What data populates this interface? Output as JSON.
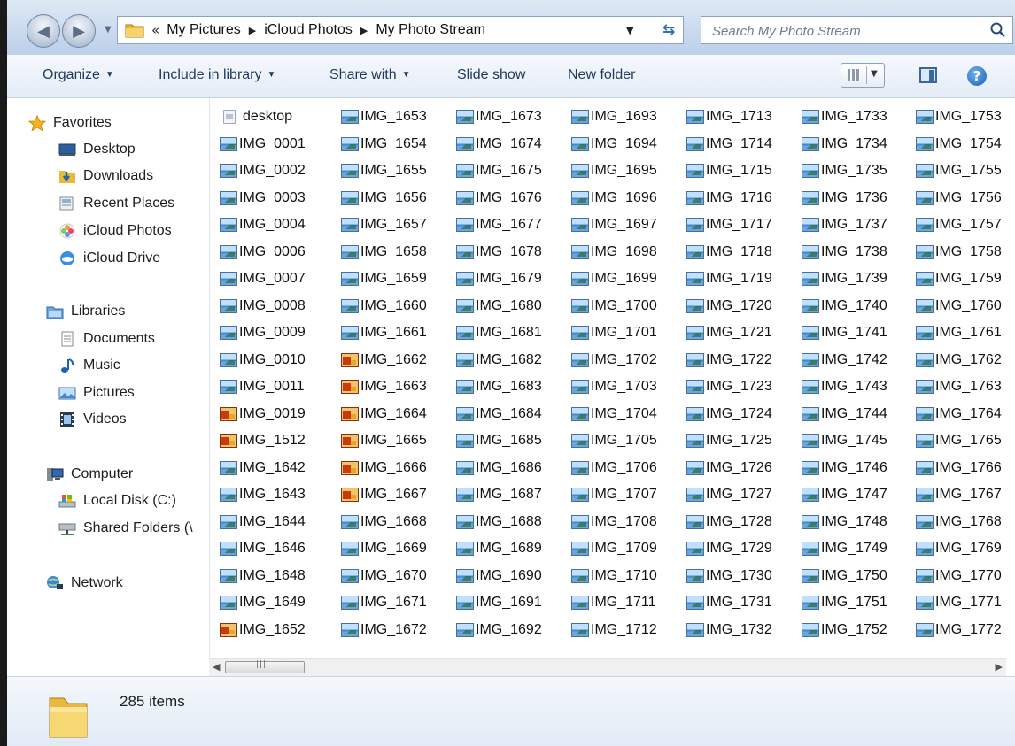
{
  "window": {
    "breadcrumb": [
      "My Pictures",
      "iCloud Photos",
      "My Photo Stream"
    ],
    "search_placeholder": "Search My Photo Stream"
  },
  "toolbar": {
    "organize": "Organize",
    "include": "Include in library",
    "share": "Share with",
    "slideshow": "Slide show",
    "newfolder": "New folder"
  },
  "nav": {
    "favorites": "Favorites",
    "desktop": "Desktop",
    "downloads": "Downloads",
    "recent": "Recent Places",
    "icloud_photos": "iCloud Photos",
    "icloud_drive": "iCloud Drive",
    "libraries": "Libraries",
    "documents": "Documents",
    "music": "Music",
    "pictures": "Pictures",
    "videos": "Videos",
    "computer": "Computer",
    "local_disk": "Local Disk (C:)",
    "shared": "Shared Folders (\\",
    "network": "Network"
  },
  "files": [
    [
      {
        "name": "desktop",
        "type": "desk"
      },
      {
        "name": "IMG_0001",
        "type": "img"
      },
      {
        "name": "IMG_0002",
        "type": "img"
      },
      {
        "name": "IMG_0003",
        "type": "img"
      },
      {
        "name": "IMG_0004",
        "type": "img"
      },
      {
        "name": "IMG_0006",
        "type": "img"
      },
      {
        "name": "IMG_0007",
        "type": "img"
      },
      {
        "name": "IMG_0008",
        "type": "img"
      },
      {
        "name": "IMG_0009",
        "type": "img"
      },
      {
        "name": "IMG_0010",
        "type": "img"
      },
      {
        "name": "IMG_0011",
        "type": "img"
      },
      {
        "name": "IMG_0019",
        "type": "raw"
      },
      {
        "name": "IMG_1512",
        "type": "raw"
      },
      {
        "name": "IMG_1642",
        "type": "img"
      },
      {
        "name": "IMG_1643",
        "type": "img"
      },
      {
        "name": "IMG_1644",
        "type": "img"
      },
      {
        "name": "IMG_1646",
        "type": "img"
      },
      {
        "name": "IMG_1648",
        "type": "img"
      },
      {
        "name": "IMG_1649",
        "type": "img"
      },
      {
        "name": "IMG_1652",
        "type": "raw"
      }
    ],
    [
      {
        "name": "IMG_1653",
        "type": "img"
      },
      {
        "name": "IMG_1654",
        "type": "img"
      },
      {
        "name": "IMG_1655",
        "type": "img"
      },
      {
        "name": "IMG_1656",
        "type": "img"
      },
      {
        "name": "IMG_1657",
        "type": "img"
      },
      {
        "name": "IMG_1658",
        "type": "img"
      },
      {
        "name": "IMG_1659",
        "type": "img"
      },
      {
        "name": "IMG_1660",
        "type": "img"
      },
      {
        "name": "IMG_1661",
        "type": "img"
      },
      {
        "name": "IMG_1662",
        "type": "raw"
      },
      {
        "name": "IMG_1663",
        "type": "raw"
      },
      {
        "name": "IMG_1664",
        "type": "raw"
      },
      {
        "name": "IMG_1665",
        "type": "raw"
      },
      {
        "name": "IMG_1666",
        "type": "raw"
      },
      {
        "name": "IMG_1667",
        "type": "raw"
      },
      {
        "name": "IMG_1668",
        "type": "img"
      },
      {
        "name": "IMG_1669",
        "type": "img"
      },
      {
        "name": "IMG_1670",
        "type": "img"
      },
      {
        "name": "IMG_1671",
        "type": "img"
      },
      {
        "name": "IMG_1672",
        "type": "img"
      }
    ],
    [
      {
        "name": "IMG_1673",
        "type": "img"
      },
      {
        "name": "IMG_1674",
        "type": "img"
      },
      {
        "name": "IMG_1675",
        "type": "img"
      },
      {
        "name": "IMG_1676",
        "type": "img"
      },
      {
        "name": "IMG_1677",
        "type": "img"
      },
      {
        "name": "IMG_1678",
        "type": "img"
      },
      {
        "name": "IMG_1679",
        "type": "img"
      },
      {
        "name": "IMG_1680",
        "type": "img"
      },
      {
        "name": "IMG_1681",
        "type": "img"
      },
      {
        "name": "IMG_1682",
        "type": "img"
      },
      {
        "name": "IMG_1683",
        "type": "img"
      },
      {
        "name": "IMG_1684",
        "type": "img"
      },
      {
        "name": "IMG_1685",
        "type": "img"
      },
      {
        "name": "IMG_1686",
        "type": "img"
      },
      {
        "name": "IMG_1687",
        "type": "img"
      },
      {
        "name": "IMG_1688",
        "type": "img"
      },
      {
        "name": "IMG_1689",
        "type": "img"
      },
      {
        "name": "IMG_1690",
        "type": "img"
      },
      {
        "name": "IMG_1691",
        "type": "img"
      },
      {
        "name": "IMG_1692",
        "type": "img"
      }
    ],
    [
      {
        "name": "IMG_1693",
        "type": "img"
      },
      {
        "name": "IMG_1694",
        "type": "img"
      },
      {
        "name": "IMG_1695",
        "type": "img"
      },
      {
        "name": "IMG_1696",
        "type": "img"
      },
      {
        "name": "IMG_1697",
        "type": "img"
      },
      {
        "name": "IMG_1698",
        "type": "img"
      },
      {
        "name": "IMG_1699",
        "type": "img"
      },
      {
        "name": "IMG_1700",
        "type": "img"
      },
      {
        "name": "IMG_1701",
        "type": "img"
      },
      {
        "name": "IMG_1702",
        "type": "img"
      },
      {
        "name": "IMG_1703",
        "type": "img"
      },
      {
        "name": "IMG_1704",
        "type": "img"
      },
      {
        "name": "IMG_1705",
        "type": "img"
      },
      {
        "name": "IMG_1706",
        "type": "img"
      },
      {
        "name": "IMG_1707",
        "type": "img"
      },
      {
        "name": "IMG_1708",
        "type": "img"
      },
      {
        "name": "IMG_1709",
        "type": "img"
      },
      {
        "name": "IMG_1710",
        "type": "img"
      },
      {
        "name": "IMG_1711",
        "type": "img"
      },
      {
        "name": "IMG_1712",
        "type": "img"
      }
    ],
    [
      {
        "name": "IMG_1713",
        "type": "img"
      },
      {
        "name": "IMG_1714",
        "type": "img"
      },
      {
        "name": "IMG_1715",
        "type": "img"
      },
      {
        "name": "IMG_1716",
        "type": "img"
      },
      {
        "name": "IMG_1717",
        "type": "img"
      },
      {
        "name": "IMG_1718",
        "type": "img"
      },
      {
        "name": "IMG_1719",
        "type": "img"
      },
      {
        "name": "IMG_1720",
        "type": "img"
      },
      {
        "name": "IMG_1721",
        "type": "img"
      },
      {
        "name": "IMG_1722",
        "type": "img"
      },
      {
        "name": "IMG_1723",
        "type": "img"
      },
      {
        "name": "IMG_1724",
        "type": "img"
      },
      {
        "name": "IMG_1725",
        "type": "img"
      },
      {
        "name": "IMG_1726",
        "type": "img"
      },
      {
        "name": "IMG_1727",
        "type": "img"
      },
      {
        "name": "IMG_1728",
        "type": "img"
      },
      {
        "name": "IMG_1729",
        "type": "img"
      },
      {
        "name": "IMG_1730",
        "type": "img"
      },
      {
        "name": "IMG_1731",
        "type": "img"
      },
      {
        "name": "IMG_1732",
        "type": "img"
      }
    ],
    [
      {
        "name": "IMG_1733",
        "type": "img"
      },
      {
        "name": "IMG_1734",
        "type": "img"
      },
      {
        "name": "IMG_1735",
        "type": "img"
      },
      {
        "name": "IMG_1736",
        "type": "img"
      },
      {
        "name": "IMG_1737",
        "type": "img"
      },
      {
        "name": "IMG_1738",
        "type": "img"
      },
      {
        "name": "IMG_1739",
        "type": "img"
      },
      {
        "name": "IMG_1740",
        "type": "img"
      },
      {
        "name": "IMG_1741",
        "type": "img"
      },
      {
        "name": "IMG_1742",
        "type": "img"
      },
      {
        "name": "IMG_1743",
        "type": "img"
      },
      {
        "name": "IMG_1744",
        "type": "img"
      },
      {
        "name": "IMG_1745",
        "type": "img"
      },
      {
        "name": "IMG_1746",
        "type": "img"
      },
      {
        "name": "IMG_1747",
        "type": "img"
      },
      {
        "name": "IMG_1748",
        "type": "img"
      },
      {
        "name": "IMG_1749",
        "type": "img"
      },
      {
        "name": "IMG_1750",
        "type": "img"
      },
      {
        "name": "IMG_1751",
        "type": "img"
      },
      {
        "name": "IMG_1752",
        "type": "img"
      }
    ],
    [
      {
        "name": "IMG_1753",
        "type": "img"
      },
      {
        "name": "IMG_1754",
        "type": "img"
      },
      {
        "name": "IMG_1755",
        "type": "img"
      },
      {
        "name": "IMG_1756",
        "type": "img"
      },
      {
        "name": "IMG_1757",
        "type": "img"
      },
      {
        "name": "IMG_1758",
        "type": "img"
      },
      {
        "name": "IMG_1759",
        "type": "img"
      },
      {
        "name": "IMG_1760",
        "type": "img"
      },
      {
        "name": "IMG_1761",
        "type": "img"
      },
      {
        "name": "IMG_1762",
        "type": "img"
      },
      {
        "name": "IMG_1763",
        "type": "img"
      },
      {
        "name": "IMG_1764",
        "type": "img"
      },
      {
        "name": "IMG_1765",
        "type": "img"
      },
      {
        "name": "IMG_1766",
        "type": "img"
      },
      {
        "name": "IMG_1767",
        "type": "img"
      },
      {
        "name": "IMG_1768",
        "type": "img"
      },
      {
        "name": "IMG_1769",
        "type": "img"
      },
      {
        "name": "IMG_1770",
        "type": "img"
      },
      {
        "name": "IMG_1771",
        "type": "img"
      },
      {
        "name": "IMG_1772",
        "type": "img"
      }
    ]
  ],
  "status": {
    "items": "285 items"
  }
}
